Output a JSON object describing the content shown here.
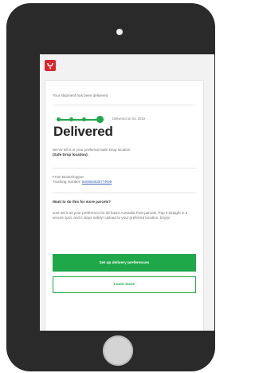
{
  "brand": {
    "logo_icon": "australia-post-logo-icon",
    "accent": "#d9262e"
  },
  "email": {
    "intro": "Your shipment has been delivered",
    "progress": {
      "steps": 4,
      "completed": 4,
      "color": "#1fa84a"
    },
    "date": "Delivered on 04, 2019",
    "status": "Delivered",
    "location_line1": "We've left it in your preferred Safe Drop location",
    "location_line2": "(Safe Drop location).",
    "from_line": "From Bookshopper",
    "tracking_label": "Tracking number:",
    "tracking_number": "5000E86307TR09",
    "question": "Want to do this for more parcels?",
    "body": "Just set it as your preference for all future Australia Post parcels. Pop it straight in a secure spot, and it stays safely! Upload to your preferred location. Enjoy!",
    "primary_button": "Set up delivery preferences",
    "secondary_button": "Learn more"
  }
}
